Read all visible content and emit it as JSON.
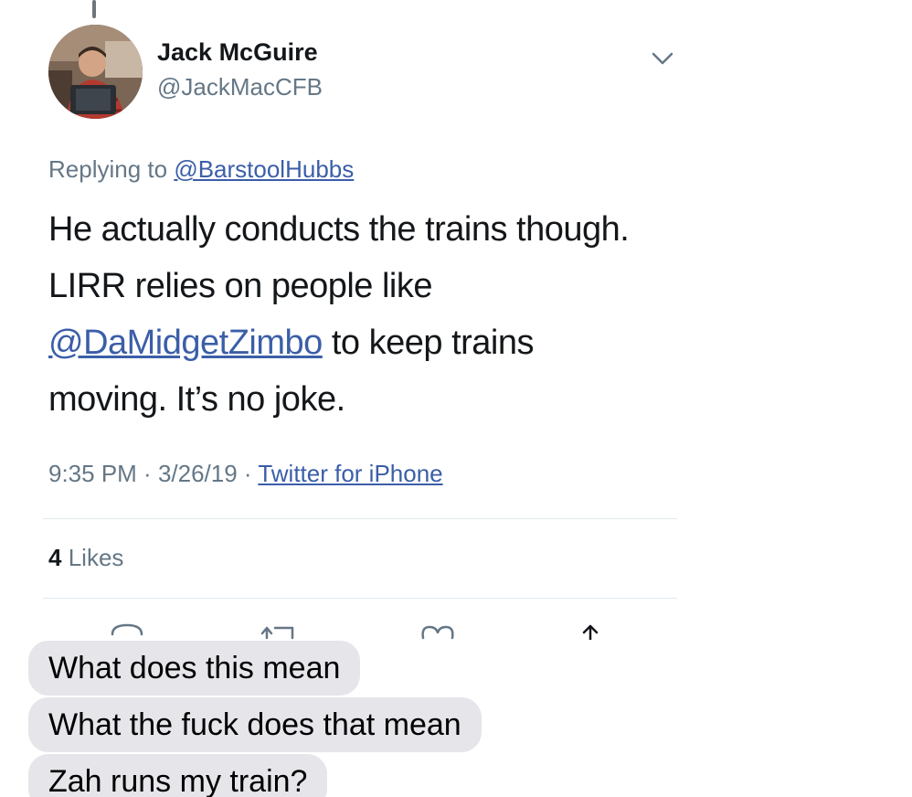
{
  "tweet": {
    "author_name": "Jack McGuire",
    "author_handle": "@JackMacCFB",
    "replying_prefix": "Replying to",
    "replying_to": "@BarstoolHubbs",
    "text_part1": "He actually conducts the trains though. LIRR relies on people like ",
    "text_mention": "@DaMidgetZimbo",
    "text_part2": " to keep trains moving. It’s no joke.",
    "time": "9:35 PM",
    "date": "3/26/19",
    "source": "Twitter for iPhone",
    "separator": " · ",
    "likes_count": "4",
    "likes_label": "Likes",
    "icons": [
      "reply-icon",
      "retweet-icon",
      "like-icon",
      "share-icon"
    ]
  },
  "messages": [
    {
      "text": "What does this mean"
    },
    {
      "text": "What the fuck does that mean"
    },
    {
      "text": "Zah runs my train?"
    }
  ],
  "colors": {
    "link": "#3b5ea8",
    "secondary_text": "#657786",
    "divider": "#e1e8ed",
    "message_bubble": "#e5e5ea"
  }
}
